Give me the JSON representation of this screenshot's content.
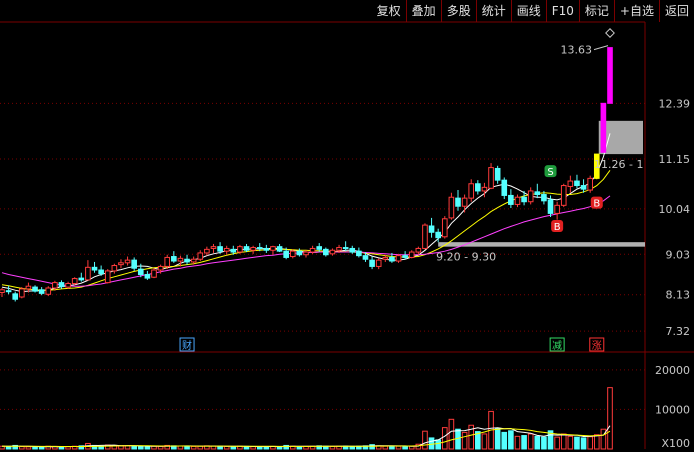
{
  "toolbar": {
    "items": [
      "复权",
      "叠加",
      "多股",
      "统计",
      "画线",
      "F10",
      "标记",
      "+自选",
      "返回"
    ]
  },
  "colors": {
    "up": "#ff3b3b",
    "down": "#54ffff",
    "ma5": "#ffffff",
    "ma10": "#ffff00",
    "ma20": "#ff40ff",
    "grid": "#7a0000",
    "band": "#b0b0b0",
    "limit_up": "#ff00ff"
  },
  "chart_data": {
    "type": "candlestick",
    "price_axis": {
      "range": [
        6.9,
        14.2
      ],
      "ticks": [
        "7.32",
        "8.13",
        "9.03",
        "10.04",
        "11.15",
        "12.39"
      ]
    },
    "volume_axis": {
      "range": [
        0,
        24000
      ],
      "ticks": [
        "10000",
        "20000"
      ],
      "unit_label": "X100"
    },
    "candles": [
      [
        8.18,
        8.28,
        8.08,
        8.24
      ],
      [
        8.22,
        8.33,
        8.14,
        8.2
      ],
      [
        8.15,
        8.2,
        7.98,
        8.03
      ],
      [
        8.08,
        8.3,
        8.05,
        8.26
      ],
      [
        8.26,
        8.4,
        8.18,
        8.32
      ],
      [
        8.3,
        8.34,
        8.18,
        8.21
      ],
      [
        8.24,
        8.3,
        8.12,
        8.16
      ],
      [
        8.14,
        8.32,
        8.1,
        8.28
      ],
      [
        8.28,
        8.44,
        8.22,
        8.4
      ],
      [
        8.4,
        8.45,
        8.26,
        8.31
      ],
      [
        8.3,
        8.42,
        8.26,
        8.38
      ],
      [
        8.38,
        8.52,
        8.34,
        8.49
      ],
      [
        8.5,
        8.62,
        8.42,
        8.46
      ],
      [
        8.46,
        8.9,
        8.45,
        8.74
      ],
      [
        8.74,
        8.86,
        8.62,
        8.68
      ],
      [
        8.68,
        8.78,
        8.55,
        8.6
      ],
      [
        8.4,
        8.7,
        8.38,
        8.66
      ],
      [
        8.66,
        8.82,
        8.6,
        8.78
      ],
      [
        8.8,
        8.92,
        8.72,
        8.84
      ],
      [
        8.84,
        8.98,
        8.78,
        8.9
      ],
      [
        8.9,
        8.96,
        8.66,
        8.72
      ],
      [
        8.7,
        8.82,
        8.52,
        8.58
      ],
      [
        8.58,
        8.66,
        8.46,
        8.5
      ],
      [
        8.52,
        8.72,
        8.5,
        8.68
      ],
      [
        8.68,
        8.8,
        8.6,
        8.76
      ],
      [
        8.76,
        9.02,
        8.7,
        8.96
      ],
      [
        8.98,
        9.1,
        8.84,
        8.88
      ],
      [
        8.88,
        9.0,
        8.76,
        8.94
      ],
      [
        8.92,
        9.02,
        8.8,
        8.86
      ],
      [
        8.86,
        8.98,
        8.8,
        8.92
      ],
      [
        8.92,
        9.12,
        8.88,
        9.06
      ],
      [
        9.06,
        9.2,
        9.0,
        9.14
      ],
      [
        9.16,
        9.26,
        9.06,
        9.2
      ],
      [
        9.2,
        9.3,
        9.04,
        9.1
      ],
      [
        9.1,
        9.22,
        9.02,
        9.16
      ],
      [
        9.14,
        9.22,
        9.02,
        9.08
      ],
      [
        9.08,
        9.24,
        9.04,
        9.2
      ],
      [
        9.2,
        9.26,
        9.08,
        9.12
      ],
      [
        9.12,
        9.22,
        9.04,
        9.18
      ],
      [
        9.18,
        9.28,
        9.1,
        9.16
      ],
      [
        9.16,
        9.24,
        9.06,
        9.12
      ],
      [
        9.12,
        9.22,
        9.02,
        9.2
      ],
      [
        9.2,
        9.26,
        9.08,
        9.1
      ],
      [
        9.1,
        9.18,
        8.92,
        8.96
      ],
      [
        8.98,
        9.14,
        8.94,
        9.1
      ],
      [
        9.1,
        9.16,
        8.98,
        9.02
      ],
      [
        9.02,
        9.12,
        8.96,
        9.08
      ],
      [
        9.08,
        9.22,
        9.04,
        9.16
      ],
      [
        9.2,
        9.28,
        9.08,
        9.14
      ],
      [
        9.14,
        9.18,
        8.98,
        9.02
      ],
      [
        9.04,
        9.16,
        9.0,
        9.12
      ],
      [
        9.12,
        9.24,
        9.06,
        9.18
      ],
      [
        9.18,
        9.32,
        9.1,
        9.16
      ],
      [
        9.16,
        9.22,
        9.04,
        9.08
      ],
      [
        9.1,
        9.18,
        8.96,
        9.0
      ],
      [
        9.0,
        9.08,
        8.86,
        8.92
      ],
      [
        8.9,
        8.98,
        8.7,
        8.76
      ],
      [
        8.76,
        8.94,
        8.7,
        8.9
      ],
      [
        8.92,
        9.02,
        8.86,
        8.96
      ],
      [
        8.96,
        9.06,
        8.84,
        8.88
      ],
      [
        8.88,
        9.04,
        8.84,
        9.0
      ],
      [
        9.0,
        9.1,
        8.92,
        8.96
      ],
      [
        8.96,
        9.12,
        8.94,
        9.08
      ],
      [
        9.08,
        9.2,
        9.02,
        9.16
      ],
      [
        9.16,
        9.72,
        9.14,
        9.68
      ],
      [
        9.66,
        9.84,
        9.4,
        9.52
      ],
      [
        9.52,
        9.6,
        9.3,
        9.4
      ],
      [
        9.42,
        9.88,
        9.38,
        9.82
      ],
      [
        9.84,
        10.4,
        9.8,
        10.3
      ],
      [
        10.28,
        10.46,
        10.0,
        10.1
      ],
      [
        10.1,
        10.36,
        9.96,
        10.28
      ],
      [
        10.28,
        10.7,
        10.2,
        10.6
      ],
      [
        10.6,
        10.68,
        10.36,
        10.44
      ],
      [
        10.44,
        10.62,
        10.3,
        10.52
      ],
      [
        10.5,
        11.06,
        10.48,
        10.96
      ],
      [
        10.94,
        11.0,
        10.6,
        10.68
      ],
      [
        10.68,
        10.74,
        10.26,
        10.34
      ],
      [
        10.34,
        10.48,
        10.06,
        10.14
      ],
      [
        10.14,
        10.36,
        10.08,
        10.3
      ],
      [
        10.3,
        10.44,
        10.12,
        10.2
      ],
      [
        10.2,
        10.52,
        10.14,
        10.44
      ],
      [
        10.42,
        10.6,
        10.28,
        10.36
      ],
      [
        10.36,
        10.44,
        10.14,
        10.22
      ],
      [
        10.24,
        10.34,
        9.86,
        9.94
      ],
      [
        9.94,
        10.2,
        9.8,
        10.12
      ],
      [
        10.12,
        10.6,
        10.08,
        10.56
      ],
      [
        10.54,
        10.78,
        10.4,
        10.66
      ],
      [
        10.66,
        10.8,
        10.5,
        10.56
      ],
      [
        10.56,
        10.7,
        10.4,
        10.48
      ],
      [
        10.46,
        10.78,
        10.4,
        10.72
      ],
      [
        10.72,
        11.26,
        10.7,
        11.26
      ],
      [
        11.3,
        12.39,
        11.3,
        12.39
      ],
      [
        12.39,
        13.63,
        12.39,
        13.63
      ]
    ],
    "volume": [
      700,
      650,
      900,
      600,
      550,
      500,
      480,
      700,
      650,
      600,
      550,
      700,
      800,
      1400,
      900,
      700,
      1000,
      900,
      850,
      800,
      700,
      650,
      600,
      700,
      650,
      900,
      800,
      750,
      700,
      650,
      700,
      800,
      750,
      700,
      650,
      600,
      700,
      650,
      600,
      620,
      600,
      650,
      600,
      900,
      700,
      600,
      650,
      700,
      800,
      700,
      650,
      700,
      750,
      650,
      700,
      800,
      1100,
      800,
      700,
      650,
      700,
      650,
      700,
      1200,
      4500,
      2800,
      2300,
      5400,
      7500,
      5000,
      4200,
      6000,
      4400,
      3800,
      9500,
      5200,
      4200,
      4600,
      3200,
      3400,
      3800,
      3200,
      3000,
      4600,
      3000,
      3800,
      3200,
      3000,
      2800,
      3100,
      3600,
      5000,
      15500
    ],
    "moving_averages": [
      {
        "name": "MA5",
        "values": [
          8.3,
          8.27,
          8.23,
          8.2,
          8.21,
          8.22,
          8.22,
          8.24,
          8.27,
          8.31,
          8.33,
          8.35,
          8.39,
          8.45,
          8.53,
          8.58,
          8.62,
          8.66,
          8.69,
          8.73,
          8.76,
          8.77,
          8.76,
          8.72,
          8.69,
          8.73,
          8.76,
          8.83,
          8.88,
          8.91,
          8.94,
          9.0,
          9.04,
          9.07,
          9.11,
          9.13,
          9.14,
          9.14,
          9.15,
          9.15,
          9.16,
          9.16,
          9.16,
          9.14,
          9.12,
          9.1,
          9.08,
          9.07,
          9.08,
          9.08,
          9.09,
          9.1,
          9.12,
          9.12,
          9.1,
          9.05,
          8.99,
          8.95,
          8.92,
          8.9,
          8.9,
          8.92,
          8.97,
          9.01,
          9.12,
          9.25,
          9.38,
          9.52,
          9.72,
          9.86,
          10.02,
          10.16,
          10.28,
          10.38,
          10.52,
          10.56,
          10.59,
          10.55,
          10.48,
          10.4,
          10.32,
          10.3,
          10.3,
          10.26,
          10.24,
          10.28,
          10.38,
          10.48,
          10.54,
          10.62,
          10.82,
          11.2,
          11.72
        ]
      },
      {
        "name": "MA10",
        "values": [
          8.35,
          8.33,
          8.3,
          8.27,
          8.25,
          8.24,
          8.23,
          8.23,
          8.24,
          8.26,
          8.27,
          8.28,
          8.3,
          8.34,
          8.39,
          8.44,
          8.49,
          8.53,
          8.57,
          8.61,
          8.65,
          8.68,
          8.71,
          8.73,
          8.74,
          8.75,
          8.76,
          8.78,
          8.8,
          8.82,
          8.85,
          8.89,
          8.93,
          8.97,
          9.01,
          9.04,
          9.07,
          9.09,
          9.11,
          9.12,
          9.13,
          9.14,
          9.14,
          9.14,
          9.13,
          9.12,
          9.12,
          9.11,
          9.11,
          9.1,
          9.1,
          9.09,
          9.09,
          9.08,
          9.07,
          9.06,
          9.04,
          9.02,
          9.0,
          8.98,
          8.97,
          8.97,
          8.97,
          8.98,
          9.02,
          9.08,
          9.15,
          9.23,
          9.33,
          9.44,
          9.55,
          9.66,
          9.77,
          9.87,
          9.98,
          10.07,
          10.15,
          10.22,
          10.28,
          10.33,
          10.36,
          10.38,
          10.4,
          10.39,
          10.37,
          10.36,
          10.36,
          10.38,
          10.42,
          10.47,
          10.56,
          10.7,
          10.9
        ]
      },
      {
        "name": "MA20",
        "values": [
          8.62,
          8.58,
          8.55,
          8.52,
          8.49,
          8.46,
          8.43,
          8.4,
          8.37,
          8.35,
          8.33,
          8.32,
          8.32,
          8.33,
          8.35,
          8.37,
          8.4,
          8.43,
          8.46,
          8.49,
          8.52,
          8.55,
          8.58,
          8.61,
          8.64,
          8.67,
          8.7,
          8.72,
          8.75,
          8.77,
          8.79,
          8.82,
          8.84,
          8.86,
          8.88,
          8.9,
          8.92,
          8.94,
          8.96,
          8.98,
          9.0,
          9.01,
          9.03,
          9.04,
          9.05,
          9.06,
          9.07,
          9.07,
          9.08,
          9.08,
          9.08,
          9.08,
          9.08,
          9.08,
          9.08,
          9.07,
          9.06,
          9.05,
          9.04,
          9.03,
          9.02,
          9.02,
          9.02,
          9.02,
          9.03,
          9.05,
          9.07,
          9.1,
          9.14,
          9.19,
          9.24,
          9.3,
          9.36,
          9.42,
          9.48,
          9.54,
          9.6,
          9.65,
          9.7,
          9.75,
          9.79,
          9.83,
          9.87,
          9.9,
          9.93,
          9.96,
          9.99,
          10.02,
          10.05,
          10.09,
          10.14,
          10.22,
          10.33
        ]
      }
    ],
    "volume_moving_averages": [
      {
        "name": "VOL-MA5",
        "values": [
          700,
          680,
          750,
          710,
          680,
          640,
          600,
          570,
          580,
          600,
          620,
          640,
          660,
          820,
          870,
          900,
          950,
          980,
          830,
          850,
          850,
          790,
          720,
          690,
          680,
          700,
          740,
          760,
          780,
          760,
          740,
          720,
          720,
          720,
          700,
          680,
          680,
          660,
          640,
          640,
          630,
          640,
          620,
          660,
          670,
          670,
          680,
          680,
          700,
          690,
          680,
          700,
          720,
          700,
          700,
          720,
          790,
          820,
          840,
          800,
          790,
          790,
          690,
          740,
          1540,
          1980,
          2300,
          3240,
          4500,
          4600,
          4640,
          4980,
          5360,
          5000,
          5260,
          5360,
          5120,
          5180,
          4400,
          4200,
          4000,
          3440,
          3240,
          3600,
          3520,
          3560,
          3480,
          3520,
          3160,
          3180,
          3300,
          3500,
          5880
        ]
      },
      {
        "name": "VOL-MA10",
        "values": [
          720,
          700,
          710,
          700,
          690,
          680,
          660,
          660,
          650,
          640,
          630,
          620,
          620,
          640,
          660,
          680,
          720,
          760,
          780,
          800,
          810,
          800,
          800,
          780,
          750,
          750,
          760,
          760,
          750,
          740,
          730,
          730,
          730,
          730,
          720,
          710,
          700,
          700,
          690,
          680,
          680,
          670,
          660,
          660,
          660,
          650,
          660,
          660,
          670,
          680,
          680,
          680,
          690,
          690,
          690,
          700,
          710,
          730,
          750,
          760,
          760,
          760,
          760,
          800,
          1000,
          1200,
          1400,
          1800,
          2300,
          2700,
          3100,
          3500,
          3900,
          4300,
          4800,
          5000,
          5100,
          5100,
          5000,
          4900,
          4700,
          4400,
          4200,
          4000,
          3800,
          3700,
          3600,
          3500,
          3400,
          3300,
          3400,
          3500,
          4500
        ]
      }
    ],
    "annotations": {
      "high_label": "13.63",
      "gap_label": "11.26 - 1",
      "band_label": "9.20 - 9.30",
      "gap_zone": [
        11.26,
        12.0
      ],
      "band_zone": [
        9.2,
        9.3
      ]
    },
    "signals": [
      {
        "label": "S",
        "index": 83,
        "price": 10.88
      },
      {
        "label": "B",
        "index": 84,
        "price": 9.66
      },
      {
        "label": "B",
        "index": 90,
        "price": 10.18
      }
    ],
    "events": [
      {
        "label": "财",
        "index": 28,
        "color": "#4aa8ff"
      },
      {
        "label": "减",
        "index": 84,
        "color": "#33dd66"
      },
      {
        "label": "涨",
        "index": 90,
        "color": "#ff3333"
      }
    ]
  }
}
